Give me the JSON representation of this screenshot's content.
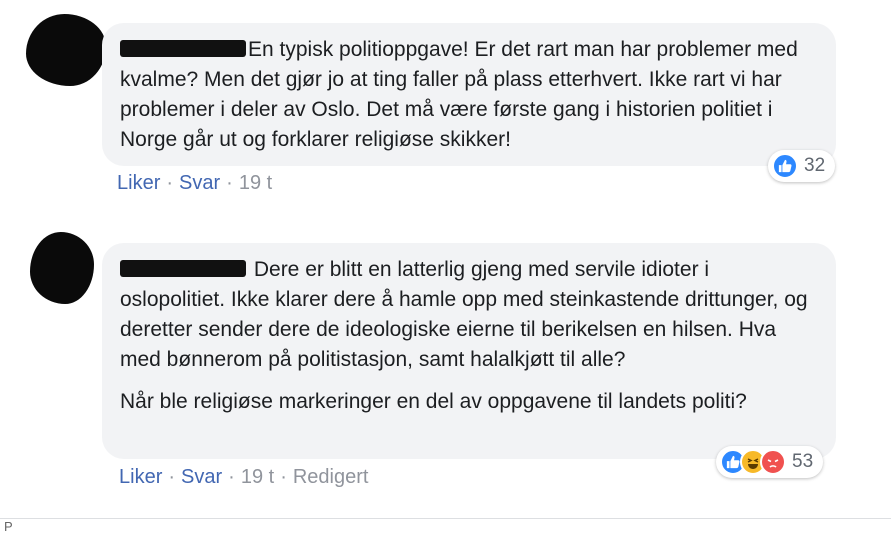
{
  "comments": [
    {
      "text_paragraphs": [
        "En typisk politioppgave! Er det rart man har problemer med kvalme? Men det gjør jo at ting faller på plass etterhvert. Ikke rart vi har problemer i deler av Oslo. Det må være første gang i historien politiet i Norge går ut og forklarer religiøse skikker!"
      ],
      "actions": {
        "like": "Liker",
        "reply": "Svar",
        "time": "19 t"
      },
      "reactions": {
        "icons": [
          "like-icon"
        ],
        "count": "32"
      }
    },
    {
      "text_paragraphs": [
        "Dere er blitt en latterlig gjeng med servile idioter i oslopolitiet. Ikke klarer dere å hamle opp med steinkastende drittunger, og deretter sender dere de ideologiske eierne til berikelsen en hilsen. Hva med bønnerom på politistasjon, samt halalkjøtt til alle?",
        "Når ble religiøse markeringer en del av oppgavene til landets politi?"
      ],
      "actions": {
        "like": "Liker",
        "reply": "Svar",
        "time": "19 t",
        "edited": "Redigert"
      },
      "reactions": {
        "icons": [
          "like-icon",
          "haha-icon",
          "angry-icon"
        ],
        "count": "53"
      }
    }
  ],
  "footer": {
    "letter": "P"
  },
  "colors": {
    "link": "#4267b2",
    "bubble": "#f2f3f5",
    "meta": "#90949c",
    "like": "#2d88ff",
    "haha": "#f7b928",
    "angry": "#f0514f"
  }
}
